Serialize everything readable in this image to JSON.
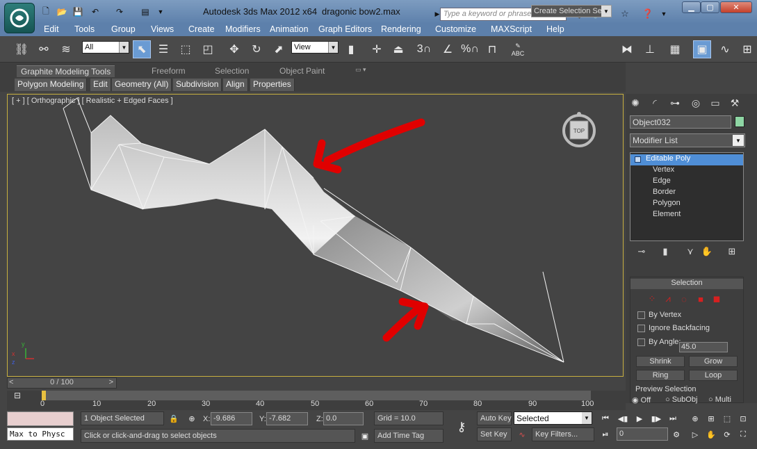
{
  "window": {
    "app_title": "Autodesk 3ds Max  2012 x64",
    "file_name": "dragonic bow2.max",
    "search_placeholder": "Type a keyword or phrase",
    "min": "▁",
    "max": "▢",
    "close": "✕"
  },
  "menu": [
    "Edit",
    "Tools",
    "Group",
    "Views",
    "Create",
    "Modifiers",
    "Animation",
    "Graph Editors",
    "Rendering",
    "Customize",
    "MAXScript",
    "Help"
  ],
  "toolbar": {
    "selection_filter": "All",
    "reference_coord": "View",
    "snap_labels": [
      "3",
      "%",
      "ABC"
    ],
    "named_selection": "Create Selection Se"
  },
  "ribbon": {
    "tabs": [
      "Graphite Modeling Tools",
      "Freeform",
      "Selection",
      "Object Paint"
    ],
    "buttons": [
      "Polygon Modeling",
      "Edit",
      "Geometry (All)",
      "Subdivision",
      "Align",
      "Properties"
    ]
  },
  "viewport": {
    "label": "[ + ] [ Orthographic ] [ Realistic + Edged Faces ]",
    "viewcube_face": "TOP",
    "axis_x": "x",
    "axis_y": "y",
    "axis_z": "z",
    "annotation_color": "#e00000"
  },
  "command_panel": {
    "object_name": "Object032",
    "object_color": "#8ed6a4",
    "modifier_list": "Modifier List",
    "stack": [
      "Editable Poly",
      "Vertex",
      "Edge",
      "Border",
      "Polygon",
      "Element"
    ],
    "selection": {
      "title": "Selection",
      "by_vertex": "By Vertex",
      "ignore_backfacing": "Ignore Backfacing",
      "by_angle": "By Angle:",
      "angle_value": "45.0",
      "shrink": "Shrink",
      "grow": "Grow",
      "ring": "Ring",
      "loop": "Loop",
      "preview": "Preview Selection",
      "preview_off": "Off",
      "preview_subobj": "SubObj",
      "preview_multi": "Multi"
    }
  },
  "timeline": {
    "slider": "0 / 100",
    "prev": "<",
    "next": ">",
    "ticks": [
      "0",
      "10",
      "20",
      "30",
      "40",
      "50",
      "60",
      "70",
      "80",
      "90",
      "100"
    ]
  },
  "status": {
    "maxscript": "Max to Physc",
    "selected": "1 Object Selected",
    "prompt": "Click or click-and-drag to select objects",
    "x_label": "X:",
    "x_value": "-9.686",
    "y_label": "Y:",
    "y_value": "-7.682",
    "z_label": "Z:",
    "z_value": "0.0",
    "grid": "Grid = 10.0",
    "add_time_tag": "Add Time Tag",
    "auto_key": "Auto Key",
    "set_key": "Set Key",
    "key_mode": "Selected",
    "key_filters": "Key Filters...",
    "frame": "0"
  }
}
